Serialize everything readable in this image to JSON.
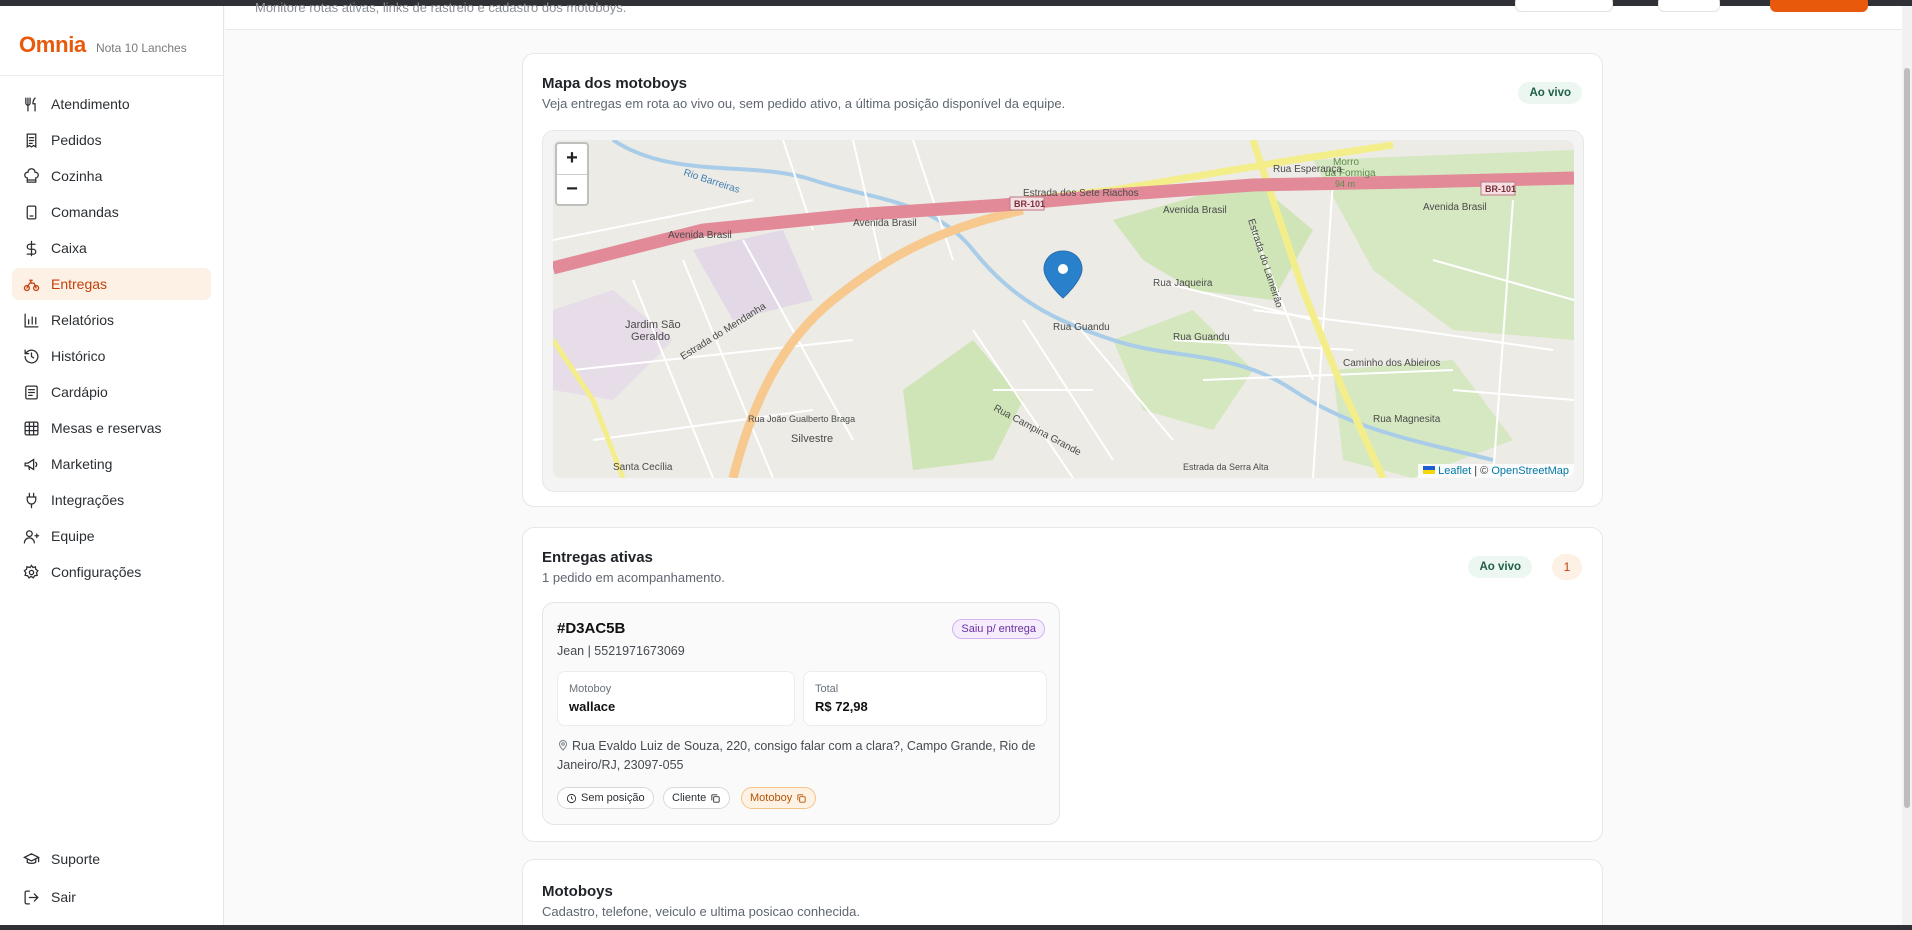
{
  "brand": {
    "logo": "Omnia",
    "store": "Nota 10 Lanches"
  },
  "sidebar": {
    "items": [
      {
        "label": "Atendimento",
        "icon": "utensils-icon"
      },
      {
        "label": "Pedidos",
        "icon": "receipt-icon"
      },
      {
        "label": "Cozinha",
        "icon": "chef-hat-icon"
      },
      {
        "label": "Comandas",
        "icon": "tablet-icon"
      },
      {
        "label": "Caixa",
        "icon": "dollar-icon"
      },
      {
        "label": "Entregas",
        "icon": "bike-icon",
        "active": true
      },
      {
        "label": "Relatórios",
        "icon": "bar-chart-icon"
      },
      {
        "label": "Histórico",
        "icon": "history-icon"
      },
      {
        "label": "Cardápio",
        "icon": "menu-book-icon"
      },
      {
        "label": "Mesas e reservas",
        "icon": "grid-icon"
      },
      {
        "label": "Marketing",
        "icon": "megaphone-icon"
      },
      {
        "label": "Integrações",
        "icon": "plug-icon"
      },
      {
        "label": "Equipe",
        "icon": "users-icon"
      },
      {
        "label": "Configurações",
        "icon": "gear-icon"
      }
    ],
    "bottom": [
      {
        "label": "Suporte",
        "icon": "graduation-cap-icon"
      },
      {
        "label": "Sair",
        "icon": "logout-icon"
      }
    ]
  },
  "header": {
    "subtitle": "Monitore rotas ativas, links de rastreio e cadastro dos motoboys."
  },
  "map_card": {
    "title": "Mapa dos motoboys",
    "description": "Veja entregas em rota ao vivo ou, sem pedido ativo, a última posição disponível da equipe.",
    "live_label": "Ao vivo",
    "zoom_in": "+",
    "zoom_out": "−",
    "attribution": {
      "leaflet": "Leaflet",
      "separator": "| ©",
      "osm": "OpenStreetMap"
    },
    "labels": {
      "avenida_brasil": "Avenida Brasil",
      "br101": "BR-101",
      "sete_riachos": "Estrada dos Sete Riachos",
      "mendanha": "Estrada do Mendanha",
      "lameirao": "Estrada do Lameirão",
      "rio_barreiras": "Rio Barreiras",
      "jardim": "Jardim São",
      "geraldo": "Geraldo",
      "silvestre": "Silvestre",
      "rua_guandu": "Rua Guandu",
      "rua_jaqueira": "Rua Jaqueira",
      "caminho": "Caminho dos Abieiros",
      "campina": "Rua Campina Grande",
      "morro": "Morro",
      "formiga": "da Formiga",
      "altitude": "94 m",
      "rua_esperanca": "Rua Esperança",
      "magnesita": "Rua Magnesita",
      "santa_cecilia": "Santa Cecília",
      "joao": "Rua João Gualberto Braga",
      "serra_alta": "Estrada da Serra Alta"
    }
  },
  "active_card": {
    "title": "Entregas ativas",
    "description": "1 pedido em acompanhamento.",
    "live_label": "Ao vivo",
    "count": "1",
    "order": {
      "id": "#D3AC5B",
      "status": "Saiu p/ entrega",
      "customer": "Jean | 5521971673069",
      "motoboy_label": "Motoboy",
      "motoboy": "wallace",
      "total_label": "Total",
      "total": "R$ 72,98",
      "address": "Rua Evaldo Luiz de Souza, 220, consigo falar com a clara?, Campo Grande, Rio de Janeiro/RJ, 23097-055",
      "chips": {
        "position": "Sem posição",
        "client": "Cliente",
        "motoboy": "Motoboy"
      }
    }
  },
  "motoboys_card": {
    "title": "Motoboys",
    "description": "Cadastro, telefone, veiculo e ultima posicao conhecida."
  },
  "colors": {
    "accent": "#e8590c",
    "active_bg": "#fdf0e4",
    "live_bg": "#ecf7f2",
    "status_purple": "#6b2fa1",
    "highway": "#e28a98",
    "primary_road": "#f7c98f",
    "secondary_road": "#f4ee8a",
    "marker": "#2a81cb"
  }
}
